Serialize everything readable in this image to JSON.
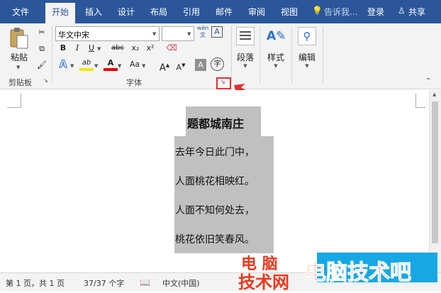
{
  "tabs": [
    "文件",
    "开始",
    "插入",
    "设计",
    "布局",
    "引用",
    "邮件",
    "审阅",
    "视图"
  ],
  "tell_me": "告诉我...",
  "login": "登录",
  "share": "共享",
  "clipboard": {
    "paste": "粘贴",
    "group": "剪贴板"
  },
  "font": {
    "name": "华文中宋",
    "size": "",
    "wen": "wén",
    "group": "字体",
    "bold": "B",
    "italic": "I",
    "underline": "U",
    "strike": "abc",
    "sub": "x₂",
    "sup": "x²",
    "effects": "A",
    "highlight": "ab",
    "color": "A",
    "grow": "A",
    "shrink": "A",
    "shade": "A",
    "enclose": "字",
    "border": "A"
  },
  "paragraph": {
    "label": "段落"
  },
  "styles": {
    "label": "样式"
  },
  "editing": {
    "label": "编辑"
  },
  "document": {
    "title": "题都城南庄",
    "lines": [
      "去年今日此门中，",
      "人面桃花相映红。",
      "人面不知何处去，",
      "桃花依旧笑春风。"
    ]
  },
  "status": {
    "page": "第 1 页，共 1 页",
    "words": "37/37 个字",
    "lang": "中文(中国)"
  },
  "watermark": {
    "left_top": "电 脑",
    "left_bottom": "技术网",
    "right": "电脑技术吧"
  },
  "colors": {
    "accent": "#2b579a",
    "highlight": "#c0c0c0",
    "callout": "#e03030"
  }
}
